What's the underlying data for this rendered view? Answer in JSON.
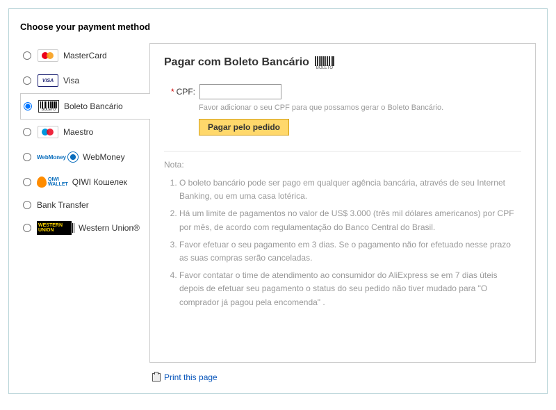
{
  "heading": "Choose your payment method",
  "sidebar": {
    "items": [
      {
        "id": "mastercard",
        "label": "MasterCard",
        "selected": false
      },
      {
        "id": "visa",
        "label": "Visa",
        "selected": false
      },
      {
        "id": "boleto",
        "label": "Boleto Bancário",
        "selected": true
      },
      {
        "id": "maestro",
        "label": "Maestro",
        "selected": false
      },
      {
        "id": "webmoney",
        "label": "WebMoney",
        "selected": false
      },
      {
        "id": "qiwi",
        "label": "QIWI Кошелек",
        "selected": false
      },
      {
        "id": "banktransfer",
        "label": "Bank Transfer",
        "selected": false
      },
      {
        "id": "westernunion",
        "label": "Western Union®",
        "selected": false
      }
    ]
  },
  "panel": {
    "title": "Pagar com Boleto Bancário",
    "cpf_label": "CPF:",
    "cpf_value": "",
    "cpf_hint": "Favor adicionar o seu CPF para que possamos gerar o Boleto Bancário.",
    "pay_button_label": "Pagar pelo pedido",
    "note_heading": "Nota:",
    "notes": [
      "O boleto bancário pode ser pago em qualquer agência bancária, através de seu Internet Banking, ou em uma casa lotérica.",
      "Há um limite de pagamentos no valor de US$ 3.000 (três mil dólares americanos) por CPF por mês, de acordo com regulamentação do Banco Central do Brasil.",
      "Favor efetuar o seu pagamento em 3 dias. Se o pagamento não for efetuado nesse prazo as suas compras serão canceladas.",
      "Favor contatar o time de atendimento ao consumidor do AliExpress se em 7 dias úteis depois de efetuar seu pagamento o status do seu pedido não tiver mudado para \"O comprador já pagou pela encomenda\" ."
    ]
  },
  "footer": {
    "print_label": "Print this page"
  }
}
